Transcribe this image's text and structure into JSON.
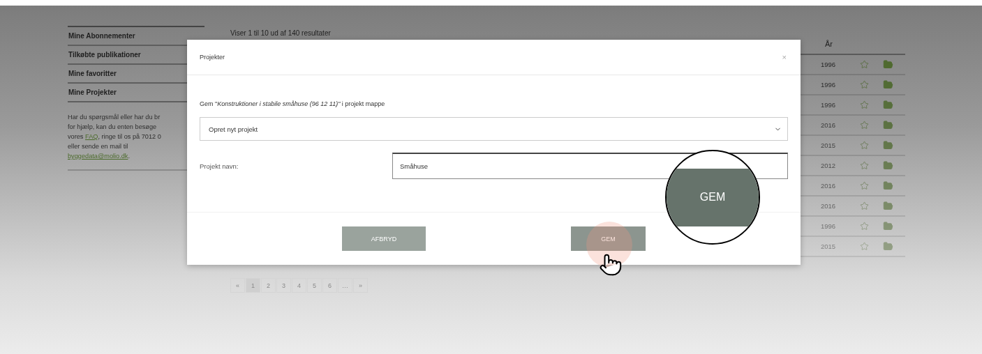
{
  "sidebar": {
    "items": [
      {
        "label": "Mine Abonnementer"
      },
      {
        "label": "Tilkøbte publikationer"
      },
      {
        "label": "Mine favoritter"
      },
      {
        "label": "Mine Projekter"
      }
    ],
    "help_lines": [
      {
        "parts": [
          {
            "text": "Har du spørgsmål eller har du br"
          }
        ]
      },
      {
        "parts": [
          {
            "text": "for hjælp, kan du enten besøge"
          }
        ]
      },
      {
        "parts": [
          {
            "text": "vores "
          },
          {
            "text": "FAQ",
            "link": true
          },
          {
            "text": ", ringe til os på 7012 0"
          }
        ]
      },
      {
        "parts": [
          {
            "text": "eller sende en mail til"
          }
        ]
      },
      {
        "parts": [
          {
            "text": "byggedata@molio.dk",
            "link": true
          },
          {
            "text": "."
          }
        ]
      }
    ]
  },
  "results": {
    "summary": "Viser 1 til 10 ud af 140 resultater",
    "year_header": "År",
    "rows": [
      {
        "year": "1996"
      },
      {
        "year": "1996"
      },
      {
        "year": "1996"
      },
      {
        "year": "2016"
      },
      {
        "year": "2015"
      },
      {
        "year": "2012"
      },
      {
        "year": "2016"
      },
      {
        "year": "2016"
      },
      {
        "year": "1996"
      },
      {
        "year": "2015"
      }
    ]
  },
  "pagination": [
    {
      "label": "«",
      "selected": false
    },
    {
      "label": "1",
      "selected": true
    },
    {
      "label": "2",
      "selected": false
    },
    {
      "label": "3",
      "selected": false
    },
    {
      "label": "4",
      "selected": false
    },
    {
      "label": "5",
      "selected": false
    },
    {
      "label": "6",
      "selected": false
    },
    {
      "label": "…",
      "selected": false
    },
    {
      "label": "»",
      "selected": false
    }
  ],
  "modal": {
    "title": "Projekter",
    "close": "×",
    "prompt": "Gem \"*Konstruktioner i stabile småhuse (96 12 11)\"* i projekt mappe",
    "select_value": "Opret nyt projekt",
    "name_label": "Projekt navn:",
    "name_value": "Småhuse",
    "cancel_button": "AFBRYD",
    "save_button": "GEM"
  },
  "magnifier": {
    "label": "GEM"
  }
}
